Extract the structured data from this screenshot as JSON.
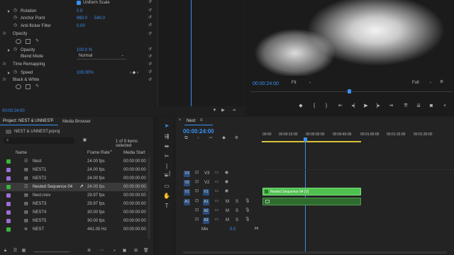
{
  "effects": {
    "uniform_scale": "Uniform Scale",
    "rotation_label": "Rotation",
    "rotation_value": "0.0",
    "anchor_label": "Anchor Point",
    "anchor_x": "960.0",
    "anchor_y": "540.0",
    "antiflicker_label": "Anti-flicker Filter",
    "antiflicker_value": "0.00",
    "opacity_header": "Opacity",
    "opacity_label": "Opacity",
    "opacity_value": "100.0 %",
    "blend_label": "Blend Mode",
    "blend_value": "Normal",
    "time_remap_header": "Time Remapping",
    "speed_label": "Speed",
    "speed_value": "100.00%",
    "bw_header": "Black & White",
    "timecode": "00:00:24:00"
  },
  "program": {
    "timecode": "00:00:24:00",
    "fit": "Fit",
    "quality": "Full"
  },
  "project": {
    "tab_project": "Project: NEST & UNNEST",
    "tab_media": "Media Browser",
    "path": "NEST & UNNEST.prproj",
    "selection": "1 of 9 items selected",
    "col_name": "Name",
    "col_fps": "Frame Rate",
    "col_start": "Media Start",
    "items": [
      {
        "name": "Nest",
        "fps": "24.00 fps",
        "start": "00:00:00:00",
        "color": "#3cb43c",
        "icon": "sequence"
      },
      {
        "name": "NEST1",
        "fps": "24.00 fps",
        "start": "00:00:00:00",
        "color": "#9b6fd6",
        "icon": "clip"
      },
      {
        "name": "NEST2",
        "fps": "24.00 fps",
        "start": "00:00:00:00",
        "color": "#9b6fd6",
        "icon": "clip"
      },
      {
        "name": "Nested Sequence 04",
        "fps": "24.00 fps",
        "start": "00:00:00:00",
        "color": "#3cb43c",
        "icon": "sequence"
      },
      {
        "name": "Nest.mov",
        "fps": "29.97 fps",
        "start": "00:00:00:00",
        "color": "#9b6fd6",
        "icon": "clip"
      },
      {
        "name": "NEST3",
        "fps": "29.97 fps",
        "start": "00:00:00:00",
        "color": "#9b6fd6",
        "icon": "clip"
      },
      {
        "name": "NEST4",
        "fps": "30.00 fps",
        "start": "00:00:00:00",
        "color": "#9b6fd6",
        "icon": "clip"
      },
      {
        "name": "NEST5",
        "fps": "30.00 fps",
        "start": "00:00:00:00",
        "color": "#9b6fd6",
        "icon": "clip"
      },
      {
        "name": "NEST",
        "fps": "441.00 Hz",
        "start": "00:00:00:00",
        "color": "#3cb43c",
        "icon": "audio"
      }
    ]
  },
  "timeline": {
    "tab": "Nest",
    "timecode": "00:00:24:00",
    "ruler": [
      "00:00",
      "00:00:15:00",
      "00:00:30:00",
      "00:00:45:00",
      "00:01:00:00",
      "00:01:15:00",
      "00:01:30:00"
    ],
    "video_tracks": [
      {
        "src": "V3",
        "name": "V3"
      },
      {
        "src": "V2",
        "name": "V2"
      },
      {
        "src": "V1",
        "name": "V1"
      }
    ],
    "audio_tracks": [
      {
        "src": "A1",
        "name": "A1"
      },
      {
        "src": "",
        "name": "A2"
      },
      {
        "src": "",
        "name": "A3"
      }
    ],
    "clip_name": "Nested Sequence 04 [V]",
    "mix_label": "Mix",
    "mix_value": "0.0",
    "m": "M",
    "s": "S"
  },
  "colors": {
    "accent": "#3b8ff0",
    "clip_green": "#4fc14f",
    "audio_green": "#2f6b2f"
  }
}
